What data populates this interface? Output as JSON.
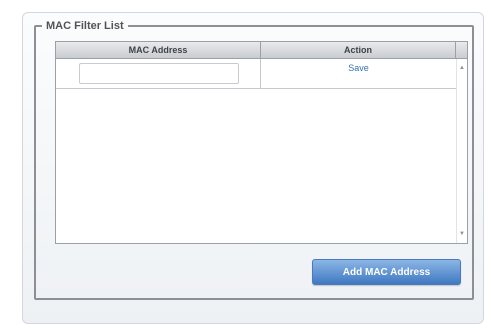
{
  "group": {
    "legend": "MAC Filter List"
  },
  "table": {
    "headers": {
      "mac": "MAC Address",
      "action": "Action"
    },
    "rows": [
      {
        "mac_value": "",
        "action_label": "Save"
      }
    ]
  },
  "scrollbar": {
    "up_icon": "▲",
    "down_icon": "▼"
  },
  "buttons": {
    "add_label": "Add MAC Address"
  },
  "colors": {
    "accent": "#3f78c2",
    "link": "#3a6fb0"
  }
}
